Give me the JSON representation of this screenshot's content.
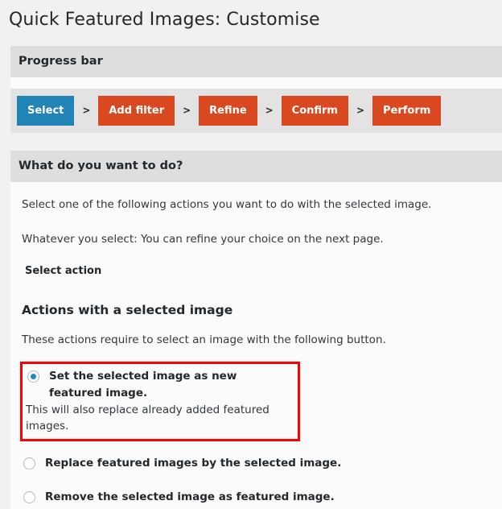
{
  "page": {
    "title": "Quick Featured Images: Customise"
  },
  "progress": {
    "header": "Progress bar",
    "separator": ">",
    "steps": [
      {
        "label": "Select",
        "state": "current"
      },
      {
        "label": "Add filter",
        "state": "pending"
      },
      {
        "label": "Refine",
        "state": "pending"
      },
      {
        "label": "Confirm",
        "state": "pending"
      },
      {
        "label": "Perform",
        "state": "pending"
      }
    ]
  },
  "main": {
    "header": "What do you want to do?",
    "intro_1": "Select one of the following actions you want to do with the selected image.",
    "intro_2": "Whatever you select: You can refine your choice on the next page.",
    "field_label": "Select action",
    "section_heading": "Actions with a selected image",
    "section_hint": "These actions require to select an image with the following button.",
    "options": [
      {
        "label": "Set the selected image as new featured image.",
        "description": "This will also replace already added featured images.",
        "checked": true,
        "highlighted": true
      },
      {
        "label": "Replace featured images by the selected image.",
        "description": "",
        "checked": false,
        "highlighted": false
      },
      {
        "label": "Remove the selected image as featured image.",
        "description": "",
        "checked": false,
        "highlighted": false
      }
    ]
  },
  "colors": {
    "accent_current": "#2283b5",
    "accent_step": "#d9481e",
    "highlight_box": "#ff0000",
    "panel_header": "#dedede",
    "page_background": "#f1f1f1"
  }
}
